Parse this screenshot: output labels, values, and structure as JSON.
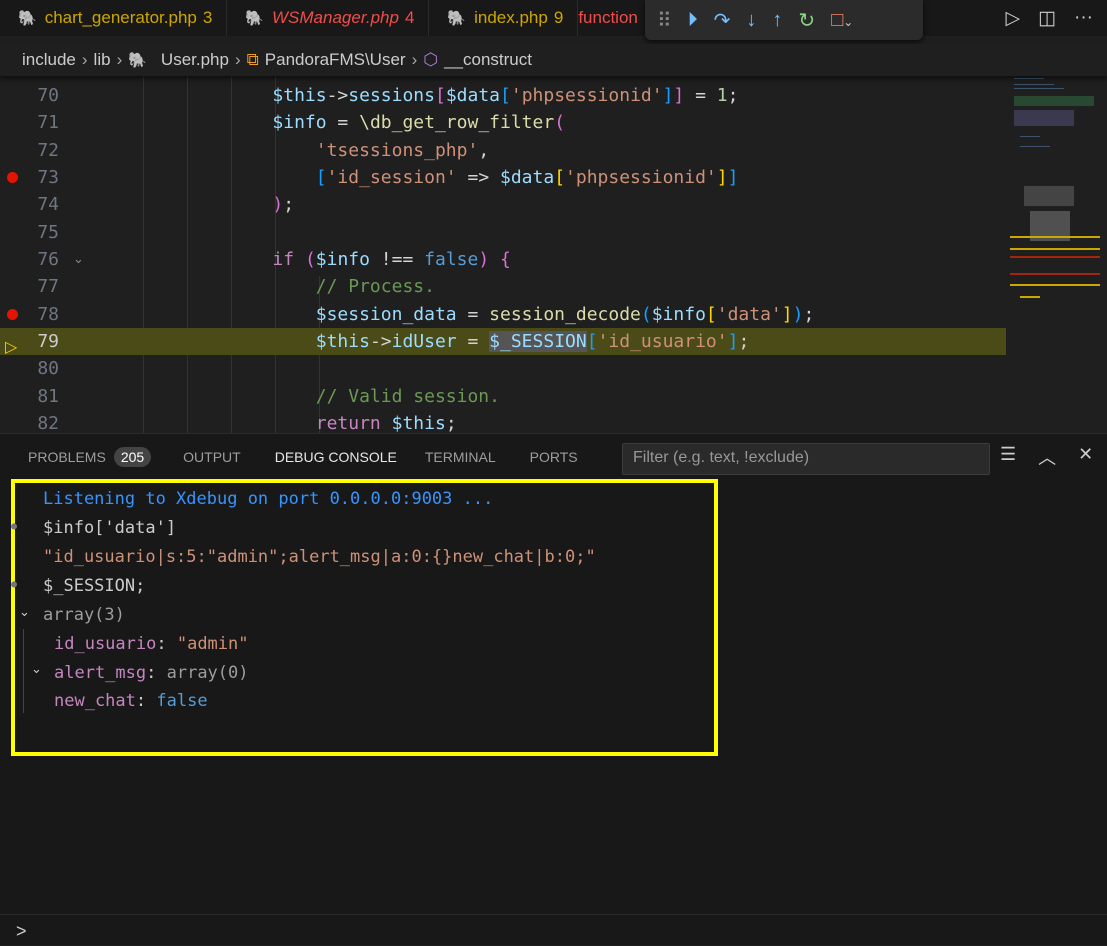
{
  "tabs": [
    {
      "label": "chart_generator.php",
      "badge": "3",
      "style": "yel"
    },
    {
      "label": "WSManager.php",
      "badge": "4",
      "style": "red"
    },
    {
      "label": "index.php",
      "badge": "9",
      "style": "yel"
    },
    {
      "label": "function",
      "badge": "",
      "style": "red"
    }
  ],
  "debug_toolbar": {
    "buttons": [
      "continue",
      "step-over",
      "step-into",
      "step-out",
      "restart",
      "stop"
    ]
  },
  "breadcrumb": [
    "include",
    "lib",
    "User.php",
    "PandoraFMS\\User",
    "__construct"
  ],
  "code_lines": [
    {
      "n": "70",
      "tokens": [
        [
          "        ",
          ""
        ],
        [
          "$this",
          "v"
        ],
        [
          "->",
          "p"
        ],
        [
          "sessions",
          "v"
        ],
        [
          "[",
          "b2"
        ],
        [
          "$data",
          "v"
        ],
        [
          "[",
          "b3"
        ],
        [
          "'phpsessionid'",
          "s"
        ],
        [
          "]",
          "b3"
        ],
        [
          "]",
          "b2"
        ],
        [
          " = ",
          "p"
        ],
        [
          "1",
          "n"
        ],
        [
          ";",
          "p"
        ]
      ]
    },
    {
      "n": "71",
      "tokens": [
        [
          "        ",
          ""
        ],
        [
          "$info",
          "v"
        ],
        [
          " = ",
          "p"
        ],
        [
          "\\db_get_row_filter",
          "f"
        ],
        [
          "(",
          "b2"
        ]
      ]
    },
    {
      "n": "72",
      "tokens": [
        [
          "            ",
          ""
        ],
        [
          "'tsessions_php'",
          "s"
        ],
        [
          ",",
          "p"
        ]
      ]
    },
    {
      "n": "73",
      "bp": true,
      "tokens": [
        [
          "            ",
          ""
        ],
        [
          "[",
          "b3"
        ],
        [
          "'id_session'",
          "s"
        ],
        [
          " => ",
          "p"
        ],
        [
          "$data",
          "v"
        ],
        [
          "[",
          "b1"
        ],
        [
          "'phpsessionid'",
          "s"
        ],
        [
          "]",
          "b1"
        ],
        [
          "]",
          "b3"
        ]
      ]
    },
    {
      "n": "74",
      "tokens": [
        [
          "        ",
          ""
        ],
        [
          ")",
          "b2"
        ],
        [
          ";",
          "p"
        ]
      ]
    },
    {
      "n": "75",
      "tokens": []
    },
    {
      "n": "76",
      "fold": true,
      "tokens": [
        [
          "        ",
          ""
        ],
        [
          "if",
          "k"
        ],
        [
          " ",
          "p"
        ],
        [
          "(",
          "b2"
        ],
        [
          "$info",
          "v"
        ],
        [
          " !== ",
          "p"
        ],
        [
          "false",
          "vb"
        ],
        [
          ")",
          "b2"
        ],
        [
          " ",
          "p"
        ],
        [
          "{",
          "b2"
        ]
      ]
    },
    {
      "n": "77",
      "tokens": [
        [
          "            ",
          ""
        ],
        [
          "// Process.",
          "c"
        ]
      ]
    },
    {
      "n": "78",
      "bp": true,
      "tokens": [
        [
          "            ",
          ""
        ],
        [
          "$session_data",
          "v"
        ],
        [
          " = ",
          "p"
        ],
        [
          "session_decode",
          "f"
        ],
        [
          "(",
          "b3"
        ],
        [
          "$info",
          "v"
        ],
        [
          "[",
          "b1"
        ],
        [
          "'data'",
          "s"
        ],
        [
          "]",
          "b1"
        ],
        [
          ")",
          "b3"
        ],
        [
          ";",
          "p"
        ]
      ]
    },
    {
      "n": "79",
      "current": true,
      "tokens": [
        [
          "            ",
          ""
        ],
        [
          "$this",
          "v"
        ],
        [
          "->",
          "p"
        ],
        [
          "idUser",
          "v"
        ],
        [
          " = ",
          "p"
        ],
        [
          "$_SESSION",
          "v sel"
        ],
        [
          "[",
          "b3"
        ],
        [
          "'id_usuario'",
          "s"
        ],
        [
          "]",
          "b3"
        ],
        [
          ";",
          "p"
        ]
      ]
    },
    {
      "n": "80",
      "tokens": []
    },
    {
      "n": "81",
      "tokens": [
        [
          "            ",
          ""
        ],
        [
          "// Valid session.",
          "c"
        ]
      ]
    },
    {
      "n": "82",
      "tokens": [
        [
          "            ",
          ""
        ],
        [
          "return",
          "k"
        ],
        [
          " ",
          "p"
        ],
        [
          "$this",
          "v"
        ],
        [
          ";",
          "p"
        ]
      ]
    }
  ],
  "panel": {
    "tabs": [
      {
        "label": "PROBLEMS",
        "badge": "205"
      },
      {
        "label": "OUTPUT"
      },
      {
        "label": "DEBUG CONSOLE",
        "active": true
      },
      {
        "label": "TERMINAL"
      },
      {
        "label": "PORTS"
      }
    ],
    "filter_placeholder": "Filter (e.g. text, !exclude)"
  },
  "console": {
    "listening": "Listening to Xdebug on port 0.0.0.0:9003 ...",
    "expr1": "$info['data']",
    "result1": "\"id_usuario|s:5:\"admin\";alert_msg|a:0:{}new_chat|b:0;\"",
    "expr2": "$_SESSION;",
    "array_label": "array(3)",
    "items": [
      {
        "key": "id_usuario",
        "value": "\"admin\""
      },
      {
        "key": "alert_msg",
        "value": "array(0)"
      },
      {
        "key": "new_chat",
        "value": "false"
      }
    ]
  },
  "input_prompt": ">"
}
